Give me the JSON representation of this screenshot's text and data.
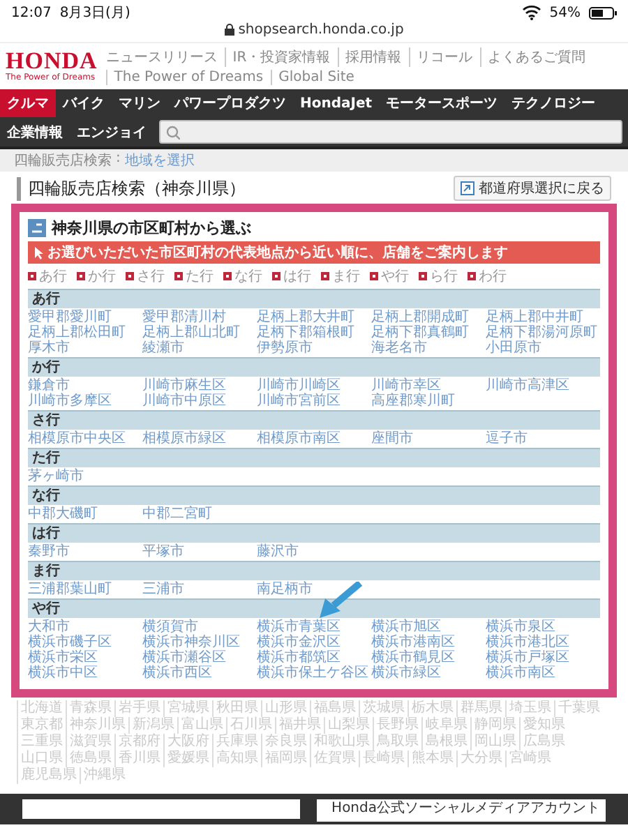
{
  "status_bar": {
    "time": "12:07",
    "date": "8月3日(月)",
    "battery": "54%"
  },
  "address_bar": {
    "url": "shopsearch.honda.co.jp"
  },
  "header": {
    "logo": "HONDA",
    "tagline": "The Power of Dreams",
    "links": [
      "ニュースリリース",
      "IR・投資家情報",
      "採用情報",
      "リコール",
      "よくあるご質問",
      "The Power of Dreams",
      "Global Site"
    ]
  },
  "nav": {
    "items": [
      {
        "label": "クルマ",
        "selected": true
      },
      {
        "label": "バイク",
        "selected": false
      },
      {
        "label": "マリン",
        "selected": false
      },
      {
        "label": "パワープロダクツ",
        "selected": false
      },
      {
        "label": "HondaJet",
        "selected": false
      },
      {
        "label": "モータースポーツ",
        "selected": false
      },
      {
        "label": "テクノロジー",
        "selected": false
      },
      {
        "label": "企業情報",
        "selected": false
      },
      {
        "label": "エンジョイ",
        "selected": false
      }
    ]
  },
  "breadcrumb": {
    "current": "四輪販売店検索",
    "separator": ":",
    "link": "地域を選択"
  },
  "page_title": "四輪販売店検索（神奈川県）",
  "back_button": "都道府県選択に戻る",
  "panel": {
    "title": "神奈川県の市区町村から選ぶ",
    "notice": "お選びいただいた市区町村の代表地点から近い順に、店舗をご案内します",
    "kana_index": [
      "あ行",
      "か行",
      "さ行",
      "た行",
      "な行",
      "は行",
      "ま行",
      "や行",
      "ら行",
      "わ行"
    ],
    "groups": [
      {
        "heading": "あ行",
        "arrow": false,
        "cities": [
          "愛甲郡愛川町",
          "愛甲郡清川村",
          "足柄上郡大井町",
          "足柄上郡開成町",
          "足柄上郡中井町",
          "足柄上郡松田町",
          "足柄上郡山北町",
          "足柄下郡箱根町",
          "足柄下郡真鶴町",
          "足柄下郡湯河原町",
          "厚木市",
          "綾瀬市",
          "伊勢原市",
          "海老名市",
          "小田原市"
        ]
      },
      {
        "heading": "か行",
        "arrow": false,
        "cities": [
          "鎌倉市",
          "川崎市麻生区",
          "川崎市川崎区",
          "川崎市幸区",
          "川崎市高津区",
          "川崎市多摩区",
          "川崎市中原区",
          "川崎市宮前区",
          "高座郡寒川町"
        ]
      },
      {
        "heading": "さ行",
        "arrow": false,
        "cities": [
          "相模原市中央区",
          "相模原市緑区",
          "相模原市南区",
          "座間市",
          "逗子市"
        ]
      },
      {
        "heading": "た行",
        "arrow": false,
        "cities": [
          "茅ヶ崎市"
        ]
      },
      {
        "heading": "な行",
        "arrow": false,
        "cities": [
          "中郡大磯町",
          "中郡二宮町"
        ]
      },
      {
        "heading": "は行",
        "arrow": false,
        "cities": [
          "秦野市",
          "平塚市",
          "藤沢市"
        ]
      },
      {
        "heading": "ま行",
        "arrow": false,
        "cities": [
          "三浦郡葉山町",
          "三浦市",
          "南足柄市"
        ]
      },
      {
        "heading": "や行",
        "arrow": true,
        "cities": [
          "大和市",
          "横須賀市",
          "横浜市青葉区",
          "横浜市旭区",
          "横浜市泉区",
          "横浜市磯子区",
          "横浜市神奈川区",
          "横浜市金沢区",
          "横浜市港南区",
          "横浜市港北区",
          "横浜市栄区",
          "横浜市瀬谷区",
          "横浜市都筑区",
          "横浜市鶴見区",
          "横浜市戸塚区",
          "横浜市中区",
          "横浜市西区",
          "横浜市保土ケ谷区",
          "横浜市緑区",
          "横浜市南区"
        ]
      }
    ]
  },
  "prefectures": [
    "北海道",
    "青森県",
    "岩手県",
    "宮城県",
    "秋田県",
    "山形県",
    "福島県",
    "茨城県",
    "栃木県",
    "群馬県",
    "埼玉県",
    "千葉県",
    "東京都",
    "神奈川県",
    "新潟県",
    "富山県",
    "石川県",
    "福井県",
    "山梨県",
    "長野県",
    "岐阜県",
    "静岡県",
    "愛知県",
    "三重県",
    "滋賀県",
    "京都府",
    "大阪府",
    "兵庫県",
    "奈良県",
    "和歌山県",
    "鳥取県",
    "島根県",
    "岡山県",
    "広島県",
    "山口県",
    "徳島県",
    "香川県",
    "愛媛県",
    "高知県",
    "福岡県",
    "佐賀県",
    "長崎県",
    "熊本県",
    "大分県",
    "宮崎県",
    "鹿児島県",
    "沖縄県"
  ],
  "footer": {
    "social_title": "Honda公式ソーシャルメディアアカウント"
  }
}
